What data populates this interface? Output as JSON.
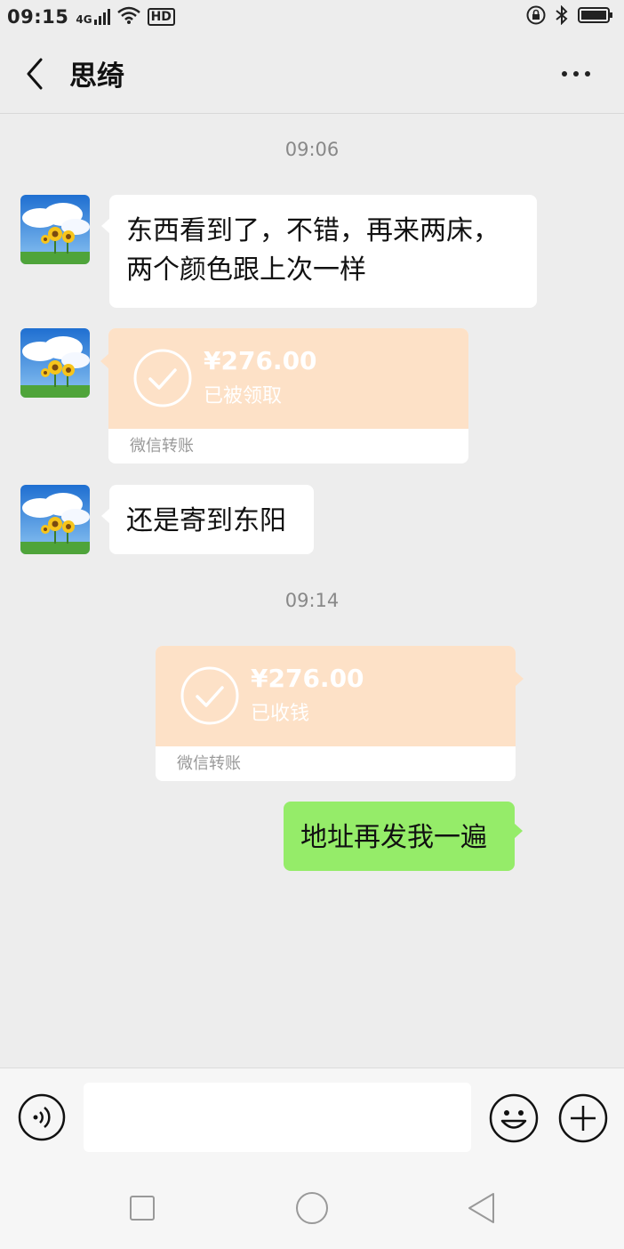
{
  "status_bar": {
    "time": "09:15",
    "network": "4G",
    "hd": "HD"
  },
  "header": {
    "title": "思绮"
  },
  "messages": {
    "time1": "09:06",
    "msg1_line1": "东西看到了，不错，再来两床，",
    "msg1_line2": "两个颜色跟上次一样",
    "transfer1": {
      "amount": "¥276.00",
      "status": "已被领取",
      "footer": "微信转账"
    },
    "msg2": "还是寄到东阳",
    "time2": "09:14",
    "transfer2": {
      "amount": "¥276.00",
      "status": "已收钱",
      "footer": "微信转账"
    },
    "msg3": "地址再发我一遍"
  },
  "input_bar": {
    "value": ""
  },
  "colors": {
    "background": "#ededed",
    "sent_bubble": "#95ec69",
    "received_bubble": "#ffffff",
    "transfer_card": "#fde1c7"
  },
  "icons": {
    "back": "back-chevron-icon",
    "more": "more-dots-icon",
    "voice": "voice-icon",
    "emoji": "emoji-icon",
    "plus": "plus-icon",
    "check": "check-circle-icon"
  }
}
